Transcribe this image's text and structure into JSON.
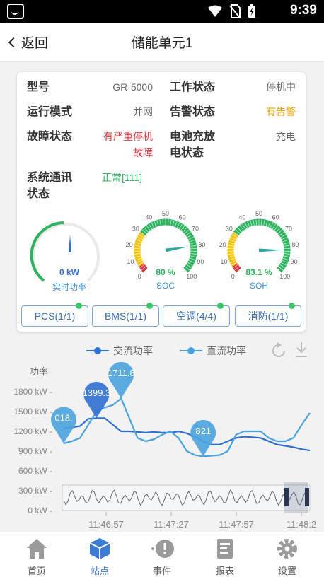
{
  "status_bar": {
    "time": "9:39"
  },
  "header": {
    "back_label": "返回",
    "title": "储能单元1"
  },
  "info": {
    "rows": [
      {
        "label": "型号",
        "value": "GR-5000",
        "tone": "normal"
      },
      {
        "label": "工作状态",
        "value": "停机中",
        "tone": "normal"
      },
      {
        "label": "运行模式",
        "value": "并网",
        "tone": "normal"
      },
      {
        "label": "告警状态",
        "value": "有告警",
        "tone": "orange"
      },
      {
        "label": "故障状态",
        "value": "有严重停机故障",
        "tone": "red"
      },
      {
        "label": "电池充放电状态",
        "value": "充电",
        "tone": "normal"
      },
      {
        "label": "系统通讯状态",
        "value": "正常[111]",
        "tone": "green"
      }
    ]
  },
  "gauges": {
    "power": {
      "value_text": "0 kW",
      "caption": "实时功率"
    },
    "soc": {
      "value": 80,
      "value_text": "80 %",
      "caption": "SOC",
      "ticks": [
        "0",
        "10",
        "20",
        "30",
        "40",
        "50",
        "60",
        "70",
        "80",
        "90",
        "100"
      ]
    },
    "soh": {
      "value": 83.1,
      "value_text": "83.1 %",
      "caption": "SOH",
      "ticks": [
        "0",
        "10",
        "20",
        "30",
        "40",
        "50",
        "60",
        "70",
        "80",
        "90",
        "100"
      ]
    }
  },
  "tabs": [
    "PCS(1/1)",
    "BMS(1/1)",
    "空调(4/4)",
    "消防(1/1)"
  ],
  "chart_data": {
    "type": "line",
    "ylabel": "功率",
    "legend": [
      "交流功率",
      "直流功率"
    ],
    "legend_placement": "top",
    "y_ticks": [
      "1800 kW",
      "1500 kW",
      "1200 kW",
      "900 kW",
      "600 kW",
      "300 kW",
      "0 kW"
    ],
    "ylim": [
      0,
      1800
    ],
    "x_ticks": [
      "11:46:57",
      "11:47:27",
      "11:47:57",
      "11:48:2"
    ],
    "series": [
      {
        "name": "交流功率",
        "color": "#2f6fd0",
        "values": [
          1250,
          1260,
          1280,
          1390,
          1400,
          1400,
          1300,
          1200,
          1200,
          1190,
          1180,
          1190,
          1180,
          1180,
          1200,
          1170,
          1120,
          1050,
          1000,
          1000,
          1050,
          1100,
          1120,
          1110,
          1100,
          1050,
          1000,
          980,
          960,
          930,
          910
        ]
      },
      {
        "name": "直流功率",
        "color": "#4aa3df",
        "values": [
          1018,
          1050,
          1100,
          1300,
          1500,
          1560,
          1600,
          1700,
          1400,
          1100,
          1050,
          1080,
          1150,
          1200,
          1100,
          900,
          840,
          821,
          830,
          840,
          900,
          1150,
          1200,
          1200,
          1200,
          1100,
          1050,
          1050,
          1100,
          1300,
          1480
        ]
      }
    ],
    "markers": [
      {
        "series": 1,
        "index": 0,
        "label": "018."
      },
      {
        "series": 0,
        "index": 4,
        "label": "1399.3"
      },
      {
        "series": 1,
        "index": 7,
        "label": "1711.8"
      },
      {
        "series": 1,
        "index": 17,
        "label": "821"
      }
    ]
  },
  "nav": [
    {
      "label": "首页",
      "icon": "home-icon",
      "active": false
    },
    {
      "label": "站点",
      "icon": "cube-icon",
      "active": true
    },
    {
      "label": "事件",
      "icon": "alert-icon",
      "active": false
    },
    {
      "label": "报表",
      "icon": "report-icon",
      "active": false
    },
    {
      "label": "设置",
      "icon": "gear-icon",
      "active": false
    }
  ],
  "colors": {
    "accent": "#3a7bd5",
    "gauge_green": "#2fb35f",
    "gauge_yellow": "#f2c40f",
    "gauge_red": "#e0373e"
  }
}
